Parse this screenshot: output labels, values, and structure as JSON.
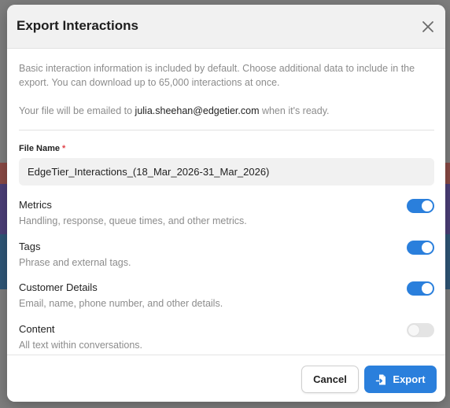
{
  "dialog": {
    "title": "Export Interactions",
    "intro": "Basic interaction information is included by default. Choose additional data to include in the export. You can download up to 65,000 interactions at once.",
    "email_prefix": "Your file will be emailed to ",
    "email": "julia.sheehan@edgetier.com",
    "email_suffix": " when it's ready.",
    "file_name_label": "File Name",
    "required_mark": "*",
    "file_name_value": "EdgeTier_Interactions_(18_Mar_2026-31_Mar_2026)",
    "options": [
      {
        "title": "Metrics",
        "description": "Handling, response, queue times, and other metrics.",
        "enabled": true
      },
      {
        "title": "Tags",
        "description": "Phrase and external tags.",
        "enabled": true
      },
      {
        "title": "Customer Details",
        "description": "Email, name, phone number, and other details.",
        "enabled": true
      },
      {
        "title": "Content",
        "description": "All text within conversations.",
        "enabled": false
      }
    ],
    "cancel_label": "Cancel",
    "export_label": "Export"
  },
  "icons": {
    "close": "close-icon",
    "export": "export-file-icon"
  },
  "colors": {
    "accent": "#2a7fdc",
    "required": "#e0434b",
    "toggle_off": "#e4e4e4",
    "header_bg": "#f1f1f1"
  }
}
